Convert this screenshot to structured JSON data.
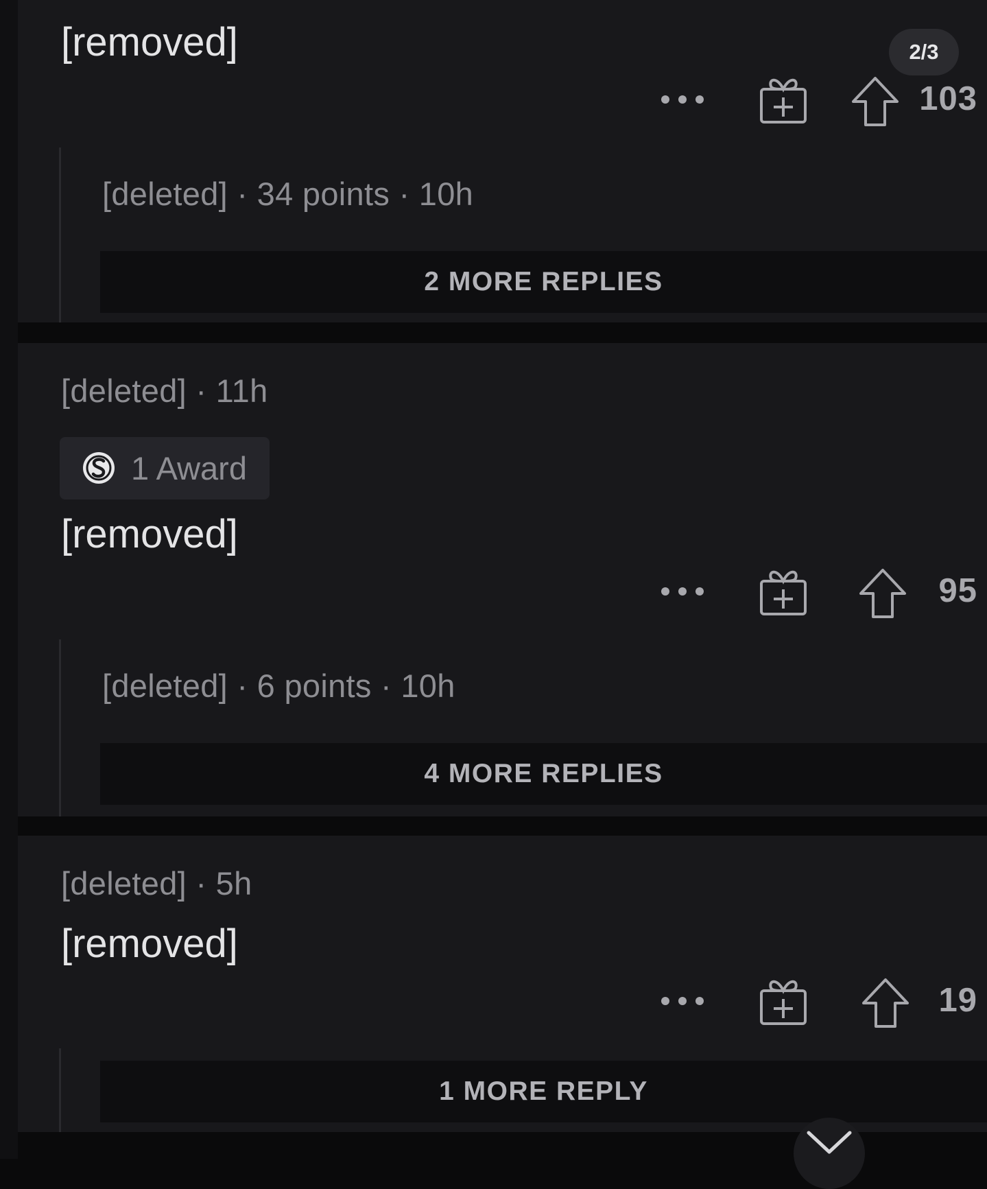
{
  "pagination": {
    "indicator": "2/3"
  },
  "comments": [
    {
      "body": "[removed]",
      "votes": "103",
      "reply": {
        "meta": "[deleted] · 34 points · 10h",
        "more_label": "2 MORE REPLIES"
      }
    },
    {
      "meta": "[deleted] · 11h",
      "award": {
        "label": "1 Award",
        "icon": "silver-award-icon"
      },
      "body": "[removed]",
      "votes": "95",
      "reply": {
        "meta": "[deleted] · 6 points · 10h",
        "more_label": "4 MORE REPLIES"
      }
    },
    {
      "meta": "[deleted] · 5h",
      "body": "[removed]",
      "votes": "19",
      "reply": {
        "more_label": "1 MORE REPLY"
      }
    }
  ],
  "icons": {
    "more": "more-options-icon",
    "gift": "gift-award-icon",
    "upvote": "upvote-arrow-icon",
    "scroll": "chevron-down-icon"
  },
  "colors": {
    "background": "#0a0a0b",
    "card": "#18181b",
    "more_replies_bg": "#0e0e10",
    "text_primary": "#e4e4e6",
    "text_muted": "#8e8e93"
  }
}
